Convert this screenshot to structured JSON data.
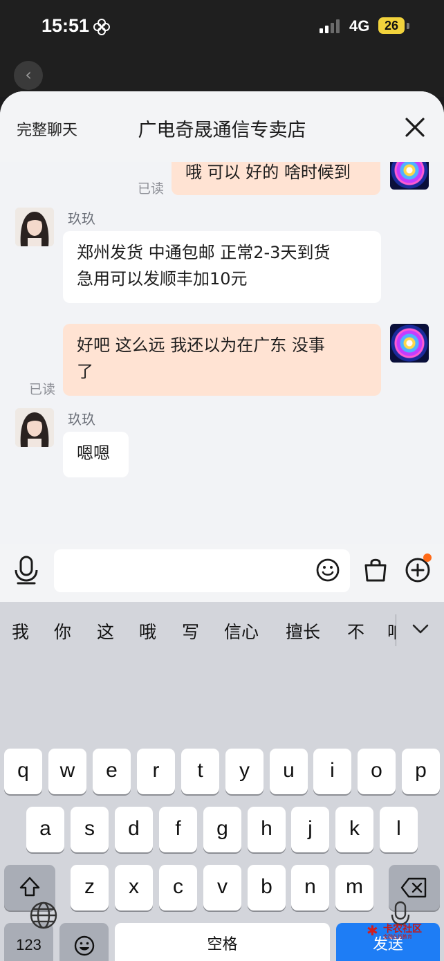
{
  "status_bar": {
    "time": "15:51",
    "network": "4G",
    "battery": "26",
    "battery_color": "#f2d33c"
  },
  "header": {
    "full_chat": "完整聊天",
    "title": "广电奇晟通信专卖店",
    "close_icon": "close-icon"
  },
  "messages": [
    {
      "side": "right",
      "text": "哦 可以 好的 啥时候到",
      "status": "已读"
    },
    {
      "side": "left",
      "sender": "玖玖",
      "text": "郑州发货 中通包邮 正常2-3天到货\n急用可以发顺丰加10元"
    },
    {
      "side": "right",
      "text": "好吧 这么远 我还以为在广东 没事\n了",
      "status": "已读"
    },
    {
      "side": "left",
      "sender": "玖玖",
      "text": "嗯嗯"
    }
  ],
  "input_bar": {
    "placeholder": "",
    "icons": [
      "mic-icon",
      "emoji-icon",
      "bag-icon",
      "plus-icon"
    ]
  },
  "keyboard": {
    "candidates": [
      "我",
      "你",
      "这",
      "哦",
      "写",
      "信心",
      "擅长",
      "不",
      "咱"
    ],
    "row1": [
      "q",
      "w",
      "e",
      "r",
      "t",
      "y",
      "u",
      "i",
      "o",
      "p"
    ],
    "row2": [
      "a",
      "s",
      "d",
      "f",
      "g",
      "h",
      "j",
      "k",
      "l"
    ],
    "row3": [
      "z",
      "x",
      "c",
      "v",
      "b",
      "n",
      "m"
    ],
    "num_key": "123",
    "space_key": "空格",
    "send_key": "发送",
    "send_color": "#1e7df5"
  },
  "watermark": {
    "title": "卡农社区",
    "subtitle": "金融在线教育"
  }
}
